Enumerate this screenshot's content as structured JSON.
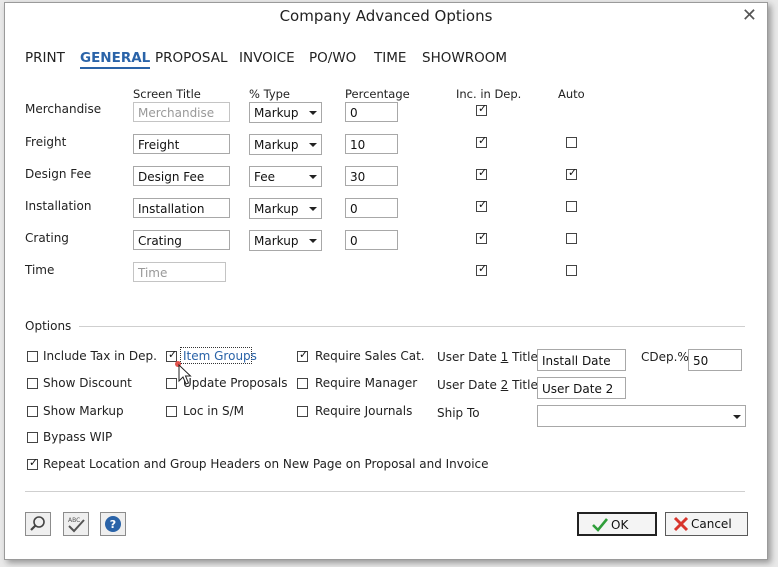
{
  "window": {
    "title": "Company Advanced Options"
  },
  "tabs": [
    {
      "label": "PRINT"
    },
    {
      "label": "GENERAL"
    },
    {
      "label": "PROPOSAL"
    },
    {
      "label": "INVOICE"
    },
    {
      "label": "PO/WO"
    },
    {
      "label": "TIME"
    },
    {
      "label": "SHOWROOM"
    }
  ],
  "active_tab": "GENERAL",
  "grid": {
    "headers": {
      "screen_title": "Screen Title",
      "type": "% Type",
      "percentage": "Percentage",
      "inc_dep": "Inc. in Dep.",
      "auto": "Auto"
    },
    "rows": [
      {
        "label": "Merchandise",
        "title": "Merchandise",
        "title_disabled": true,
        "type": "Markup",
        "percentage": "0",
        "inc_dep": true,
        "auto": null
      },
      {
        "label": "Freight",
        "title": "Freight",
        "title_disabled": false,
        "type": "Markup",
        "percentage": "10",
        "inc_dep": true,
        "auto": false
      },
      {
        "label": "Design Fee",
        "title": "Design Fee",
        "title_disabled": false,
        "type": "Fee",
        "percentage": "30",
        "inc_dep": true,
        "auto": true
      },
      {
        "label": "Installation",
        "title": "Installation",
        "title_disabled": false,
        "type": "Markup",
        "percentage": "0",
        "inc_dep": true,
        "auto": false
      },
      {
        "label": "Crating",
        "title": "Crating",
        "title_disabled": false,
        "type": "Markup",
        "percentage": "0",
        "inc_dep": true,
        "auto": false
      },
      {
        "label": "Time",
        "title": "Time",
        "title_disabled": true,
        "type": null,
        "percentage": null,
        "inc_dep": true,
        "auto": false
      }
    ]
  },
  "options": {
    "section_label": "Options",
    "include_tax": {
      "label": "Include Tax in Dep.",
      "checked": false
    },
    "show_discount": {
      "label": "Show Discount",
      "checked": false
    },
    "show_markup": {
      "label": "Show Markup",
      "checked": false
    },
    "bypass_wip": {
      "label": "Bypass WIP",
      "checked": false
    },
    "item_groups": {
      "label": "Item Groups",
      "checked": true
    },
    "update_proposals": {
      "label": "Update Proposals",
      "checked": false
    },
    "loc_in_sm": {
      "label": "Loc in S/M",
      "checked": false
    },
    "require_sales_cat": {
      "label": "Require Sales Cat.",
      "checked": true
    },
    "require_manager": {
      "label": "Require Manager",
      "checked": false
    },
    "require_journals": {
      "label": "Require Journals",
      "checked": false
    },
    "user_date_1": {
      "label_pre": "User Date ",
      "label_num": "1",
      "label_post": " Title",
      "value": "Install Date"
    },
    "user_date_2": {
      "label_pre": "User Date ",
      "label_num": "2",
      "label_post": " Title",
      "value": "User Date 2"
    },
    "cdep": {
      "label": "CDep.%",
      "value": "50"
    },
    "ship_to": {
      "label": "Ship To",
      "value": ""
    },
    "repeat_headers": {
      "label": "Repeat Location and Group Headers on New Page on Proposal and Invoice",
      "checked": true
    }
  },
  "buttons": {
    "ok": "OK",
    "cancel": "Cancel"
  },
  "colors": {
    "accent": "#2a63a8",
    "ok_check": "#2f9e3a",
    "cancel_x": "#d8342c",
    "help": "#2a63a8"
  }
}
